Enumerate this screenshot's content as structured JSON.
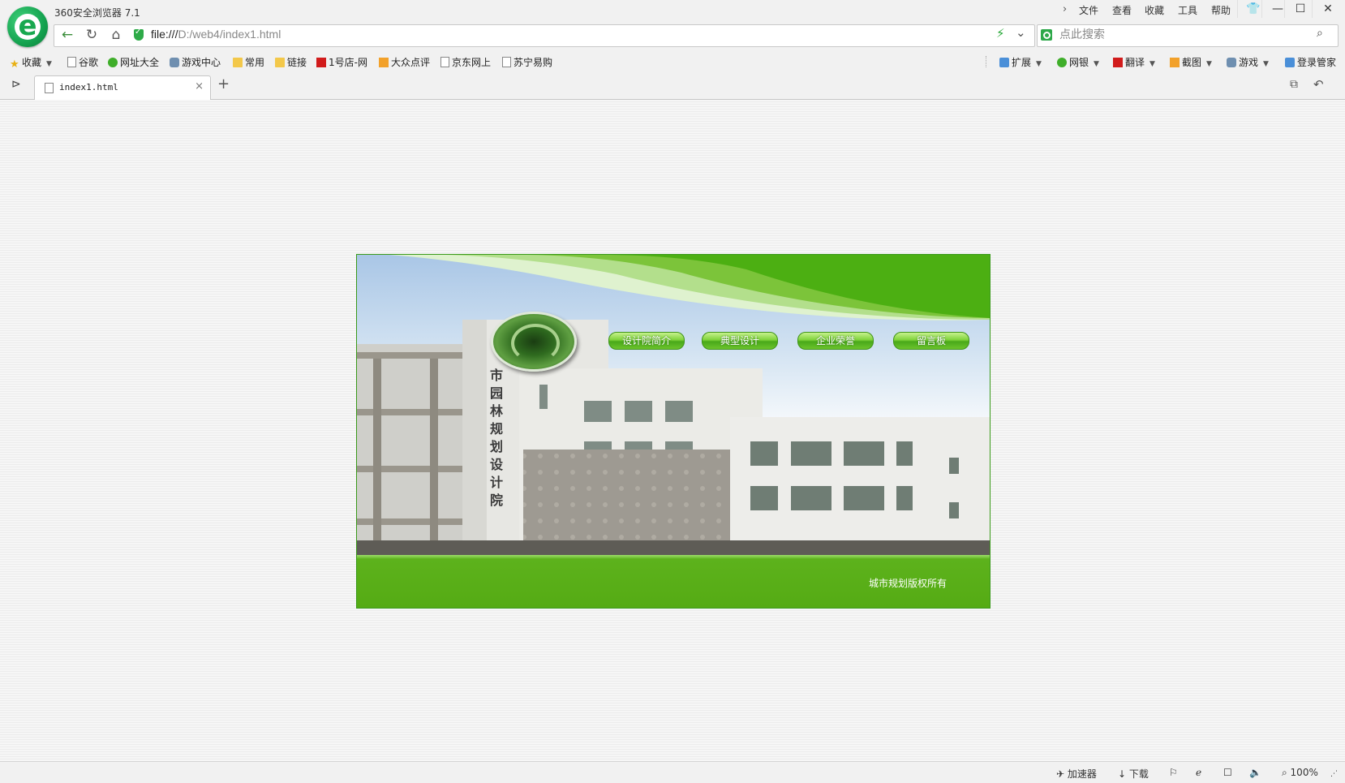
{
  "browser": {
    "app_title": "360安全浏览器 7.1",
    "menu": [
      "文件",
      "查看",
      "收藏",
      "工具",
      "帮助"
    ],
    "window_controls": {
      "skin": "👕",
      "minimize": "—",
      "maximize": "☐",
      "close": "✕"
    }
  },
  "address_bar": {
    "url_scheme": "file:///",
    "url_path": "D:/web4/index1.html",
    "search_placeholder": "点此搜索"
  },
  "bookmarks": {
    "left": [
      {
        "label": "收藏",
        "icon": "star-icon"
      },
      {
        "label": "谷歌",
        "icon": "page-icon"
      },
      {
        "label": "网址大全",
        "icon": "green-circle-icon"
      },
      {
        "label": "游戏中心",
        "icon": "gamepad-icon"
      },
      {
        "label": "常用",
        "icon": "folder-icon"
      },
      {
        "label": "链接",
        "icon": "folder-icon"
      },
      {
        "label": "1号店-网",
        "icon": "yhd-icon"
      },
      {
        "label": "大众点评",
        "icon": "dianping-icon"
      },
      {
        "label": "京东网上",
        "icon": "page-icon"
      },
      {
        "label": "苏宁易购",
        "icon": "page-icon"
      }
    ],
    "right": [
      {
        "label": "扩展",
        "icon": "extensions-icon"
      },
      {
        "label": "网银",
        "icon": "bank-icon"
      },
      {
        "label": "翻译",
        "icon": "translate-icon"
      },
      {
        "label": "截图",
        "icon": "screenshot-icon"
      },
      {
        "label": "游戏",
        "icon": "game-icon"
      },
      {
        "label": "登录管家",
        "icon": "login-manager-icon"
      }
    ]
  },
  "tabs": [
    {
      "label": "index1.html",
      "active": true
    }
  ],
  "page": {
    "site_name": "市园林规划设计院",
    "nav": [
      "设计院简介",
      "典型设计",
      "企业荣誉",
      "留言板"
    ],
    "copyright": "城市规划版权所有",
    "colors": {
      "green": "#55ab14",
      "border": "#3a9a1a"
    }
  },
  "status_bar": {
    "accelerator": "加速器",
    "download": "下载",
    "zoom": "100%"
  }
}
